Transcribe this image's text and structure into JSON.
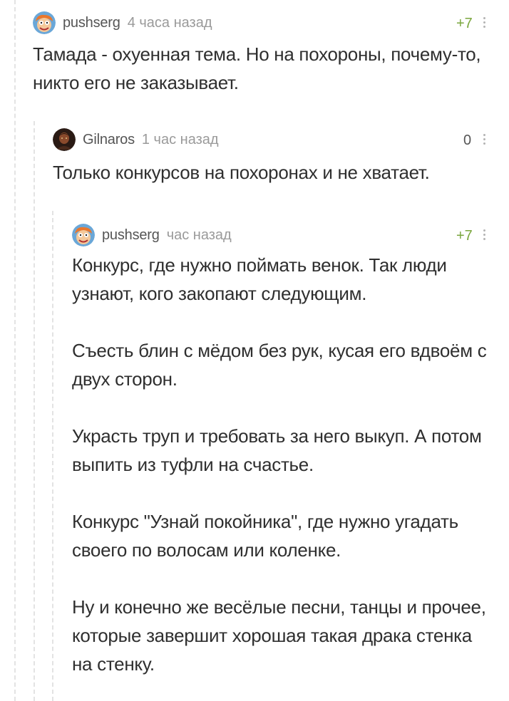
{
  "comments": [
    {
      "author": "pushserg",
      "time": "4 часа назад",
      "rating": "+7",
      "avatar_icon": "cartoon-face-icon",
      "paragraphs": [
        "Тамада - охуенная тема. Но на похороны, почему-то, никто его не заказывает."
      ]
    },
    {
      "author": "Gilnaros",
      "time": "1 час назад",
      "rating": "0",
      "avatar_icon": "dark-portrait-icon",
      "paragraphs": [
        "Только конкурсов на похоронах и не хватает."
      ]
    },
    {
      "author": "pushserg",
      "time": "час назад",
      "rating": "+7",
      "avatar_icon": "cartoon-face-icon",
      "paragraphs": [
        "Конкурс, где нужно поймать венок. Так люди узнают, кого закопают следующим.",
        "Съесть блин с мёдом без рук, кусая его вдвоём с двух сторон.",
        "Украсть труп и требовать за него выкуп. А потом выпить из туфли на счастье.",
        "Конкурс \"Узнай покойника\", где нужно угадать своего по волосам или коленке.",
        "Ну и конечно же весёлые песни, танцы и прочее, которые завершит хорошая такая драка стенка на стенку."
      ]
    }
  ],
  "colors": {
    "positive_rating": "#7aa63d",
    "text": "#2f2f2f",
    "meta": "#9a9a9a",
    "thread_line": "#e3e3e3"
  }
}
